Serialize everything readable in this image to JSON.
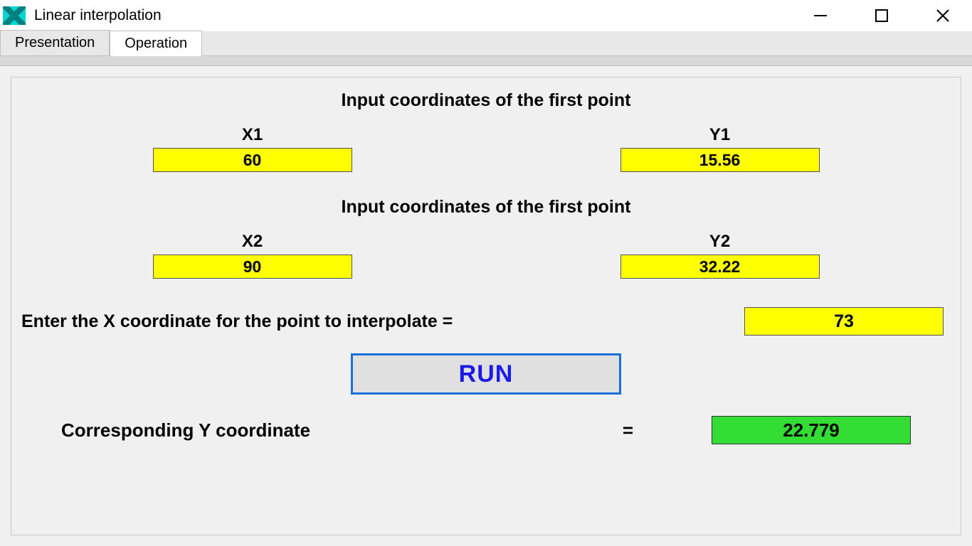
{
  "window": {
    "title": "Linear interpolation"
  },
  "tabs": {
    "presentation": "Presentation",
    "operation": "Operation"
  },
  "sections": {
    "first_point_title": "Input coordinates of the first point",
    "second_point_title": "Input coordinates of the first point",
    "x1_label": "X1",
    "y1_label": "Y1",
    "x2_label": "X2",
    "y2_label": "Y2"
  },
  "values": {
    "x1": "60",
    "y1": "15.56",
    "x2": "90",
    "y2": "32.22",
    "x_interp": "73",
    "y_result": "22.779"
  },
  "interp": {
    "prompt": "Enter the X coordinate for the point to interpolate ="
  },
  "run": {
    "label": "RUN"
  },
  "result": {
    "label": "Corresponding Y coordinate",
    "equals": "="
  }
}
